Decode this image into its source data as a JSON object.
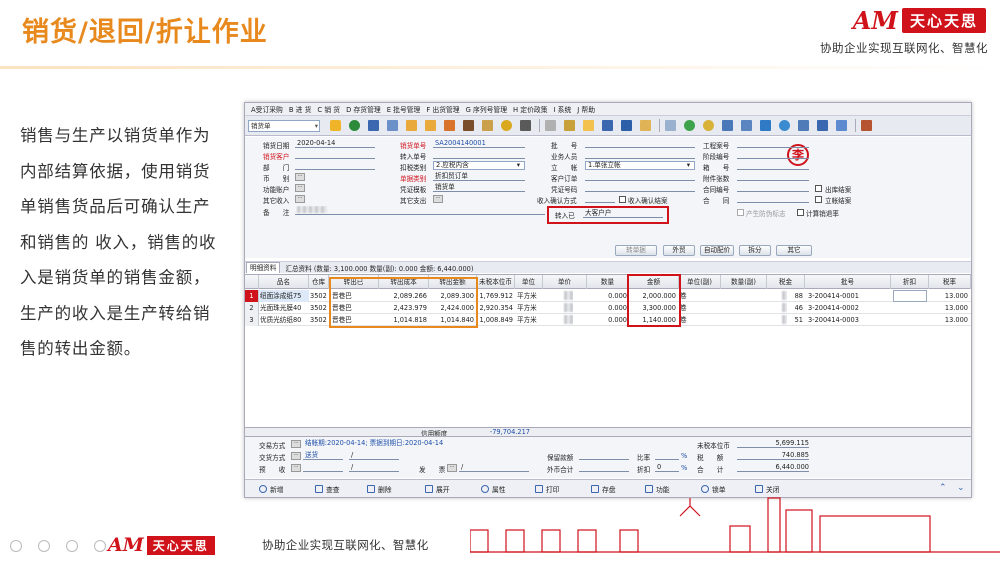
{
  "slide": {
    "title": "销货/退回/折让作业",
    "slogan": "协助企业实现互联网化、智慧化",
    "brand_am": "AM",
    "brand_name": "天心天思",
    "body_text": "销售与生产以销货单作为内部结算依据，使用销货单销售货品后可确认生产和销售的 收入，销售的收入是销货单的销售金额，生产的收入是生产转给销售的转出金额。"
  },
  "app": {
    "menu": [
      "A受订采购",
      "B 进 货",
      "C 销 货",
      "D 存货管理",
      "E 批号管理",
      "F 出货管理",
      "G 序列号管理",
      "H 定价政策",
      "I 系统",
      "J 帮助"
    ],
    "doc_type": "销货单",
    "form": {
      "sale_date_label": "销货日期",
      "sale_date": "2020-04-14",
      "customer_label": "销货客户",
      "dept_label": "部　　门",
      "currency_label": "币　　别",
      "func_label": "功能账户",
      "other_income_label": "其它收入",
      "note_label": "备　　注",
      "doc_no_label": "销货单号",
      "doc_no": "SA2004140001",
      "transfer_no_label": "转入单号",
      "tax_type_label": "扣税类别",
      "tax_type": "2.应税内含",
      "src_type_label": "单据类别",
      "src_type": "折扣贸订单",
      "voucher_tpl_label": "凭证模板",
      "voucher_tpl": "销货单",
      "other_exp_label": "其它支出",
      "batch_label": "批　　号",
      "salesman_label": "业务人员",
      "ledger_label": "立　　帐",
      "ledger": "1.单张立帐",
      "cust_order_label": "客户订单",
      "voucher_no_label": "凭证号码",
      "income_method_label": "收入确认方式",
      "income_confirm_label": "收入确认结案",
      "transfer_in_label": "转入已",
      "transfer_in": "大客户户",
      "project_label": "工程案号",
      "stage_label": "阶段编号",
      "box_label": "箱　　号",
      "attach_label": "附件张数",
      "contract_label": "合同编号",
      "contract2_label": "合　　同",
      "out_closed_label": "出库结案",
      "closed_label": "立帐结案",
      "warranty_label": "产生防伪标志",
      "calc_return_label": "计算销退率",
      "seal_char": "李"
    },
    "buttons": {
      "transfer": "转单据",
      "outsource": "外贸",
      "auto_price": "自动配价",
      "split": "拆分",
      "other": "其它"
    },
    "tabs": {
      "detail": "明细资料",
      "summary": "汇总资料 (数量: 3,100.000 数量(副): 0.000 金额: 6,440.000)"
    },
    "columns": [
      "",
      "品名",
      "仓库",
      "转出已",
      "转出成本",
      "转出金额",
      "未税本位币",
      "单位",
      "单价",
      "数量",
      "金额",
      "单位(副)",
      "数量(副)",
      "税金",
      "批号",
      "折扣",
      "税率"
    ],
    "rows": [
      {
        "idx": "1",
        "name": "纽面涂成纸75",
        "wh": "3502",
        "out": "晋巷巴",
        "cost": "2,089.266",
        "amt": "2,089.300",
        "untax": "1,769.912",
        "unit": "平方米",
        "qty": "0.000",
        "money": "2,000.000",
        "unit2": "卷",
        "tax": "88",
        "batch": "3-200414-0001",
        "rate": "13.000"
      },
      {
        "idx": "2",
        "name": "光面珠光膜40",
        "wh": "3502",
        "out": "晋巷巴",
        "cost": "2,423.979",
        "amt": "2,424.000",
        "untax": "2,920.354",
        "unit": "平方米",
        "qty": "0.000",
        "money": "3,300.000",
        "unit2": "卷",
        "tax": "46",
        "batch": "3-200414-0002",
        "rate": "13.000"
      },
      {
        "idx": "3",
        "name": "优质光纺纸80",
        "wh": "3502",
        "out": "晋巷巴",
        "cost": "1,014.818",
        "amt": "1,014.840",
        "untax": "1,008.849",
        "unit": "平方米",
        "qty": "0.000",
        "money": "1,140.000",
        "unit2": "卷",
        "tax": "51",
        "batch": "3-200414-0003",
        "rate": "13.000"
      }
    ],
    "credit_label": "信用额度",
    "credit_value": "-79,704.217",
    "footer": {
      "trade_label": "交易方式",
      "trade_value": "结帐期:2020-04-14; 票据到期日:2020-04-14",
      "ship_label": "交货方式",
      "ship_value": "送货",
      "discount_label": "预　　收",
      "invoice_label": "发　　票",
      "retain_label": "保留款额",
      "fx_label": "外币合计",
      "ratio_label": "比率",
      "ratio_unit": "%",
      "disc_label": "折扣",
      "disc_value": "0",
      "disc_unit": "%",
      "untax_cur_label": "未税本位币",
      "untax_cur": "5,699.115",
      "tax_label": "税　　额",
      "tax_value": "740.885",
      "total_label": "合　　计",
      "total_value": "6,440.000"
    },
    "bottom_buttons": [
      "新增",
      "查查",
      "删除",
      "展开",
      "属性",
      "打印",
      "存盘",
      "功能",
      "锁单",
      "关闭"
    ]
  },
  "colors": {
    "accent": "#e8891d",
    "brand_red": "#d0121b"
  }
}
